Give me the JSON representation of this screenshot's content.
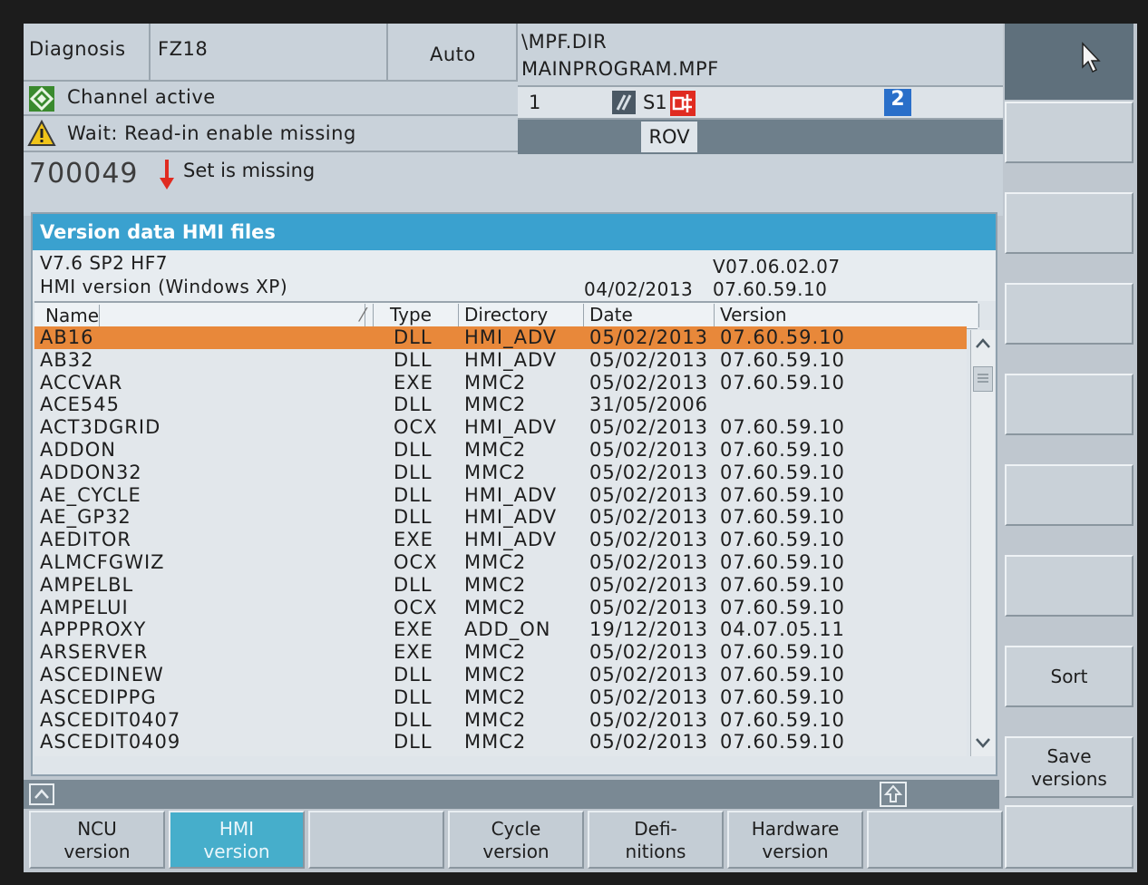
{
  "header": {
    "area": "Diagnosis",
    "channel": "FZ18",
    "mode": "Auto",
    "program_path": "\\MPF.DIR",
    "program_name": "MAINPROGRAM.MPF",
    "channel_status": "Channel active",
    "program_status": "Wait: Read-in enable missing",
    "block_number": "1",
    "spindle": "S1",
    "override": "ROV",
    "channel_number": "2"
  },
  "alarm": {
    "number": "700049",
    "text": "Set is missing"
  },
  "panel": {
    "title": "Version data HMI files",
    "release": "V7.6 SP2 HF7",
    "release_version": "V07.06.02.07",
    "hmi_label": "HMI version (Windows XP)",
    "hmi_date": "04/02/2013",
    "hmi_version": "07.60.59.10"
  },
  "table": {
    "columns": [
      "Name",
      "Type",
      "Directory",
      "Date",
      "Version"
    ],
    "rows": [
      {
        "name": "AB16",
        "type": "DLL",
        "dir": "HMI_ADV",
        "date": "05/02/2013",
        "version": "07.60.59.10"
      },
      {
        "name": "AB32",
        "type": "DLL",
        "dir": "HMI_ADV",
        "date": "05/02/2013",
        "version": "07.60.59.10"
      },
      {
        "name": "ACCVAR",
        "type": "EXE",
        "dir": "MMC2",
        "date": "05/02/2013",
        "version": "07.60.59.10"
      },
      {
        "name": "ACE545",
        "type": "DLL",
        "dir": "MMC2",
        "date": "31/05/2006",
        "version": ""
      },
      {
        "name": "ACT3DGRID",
        "type": "OCX",
        "dir": "HMI_ADV",
        "date": "05/02/2013",
        "version": "07.60.59.10"
      },
      {
        "name": "ADDON",
        "type": "DLL",
        "dir": "MMC2",
        "date": "05/02/2013",
        "version": "07.60.59.10"
      },
      {
        "name": "ADDON32",
        "type": "DLL",
        "dir": "MMC2",
        "date": "05/02/2013",
        "version": "07.60.59.10"
      },
      {
        "name": "AE_CYCLE",
        "type": "DLL",
        "dir": "HMI_ADV",
        "date": "05/02/2013",
        "version": "07.60.59.10"
      },
      {
        "name": "AE_GP32",
        "type": "DLL",
        "dir": "HMI_ADV",
        "date": "05/02/2013",
        "version": "07.60.59.10"
      },
      {
        "name": "AEDITOR",
        "type": "EXE",
        "dir": "HMI_ADV",
        "date": "05/02/2013",
        "version": "07.60.59.10"
      },
      {
        "name": "ALMCFGWIZ",
        "type": "OCX",
        "dir": "MMC2",
        "date": "05/02/2013",
        "version": "07.60.59.10"
      },
      {
        "name": "AMPELBL",
        "type": "DLL",
        "dir": "MMC2",
        "date": "05/02/2013",
        "version": "07.60.59.10"
      },
      {
        "name": "AMPELUI",
        "type": "OCX",
        "dir": "MMC2",
        "date": "05/02/2013",
        "version": "07.60.59.10"
      },
      {
        "name": "APPPROXY",
        "type": "EXE",
        "dir": "ADD_ON",
        "date": "19/12/2013",
        "version": "04.07.05.11"
      },
      {
        "name": "ARSERVER",
        "type": "EXE",
        "dir": "MMC2",
        "date": "05/02/2013",
        "version": "07.60.59.10"
      },
      {
        "name": "ASCEDINEW",
        "type": "DLL",
        "dir": "MMC2",
        "date": "05/02/2013",
        "version": "07.60.59.10"
      },
      {
        "name": "ASCEDIPPG",
        "type": "DLL",
        "dir": "MMC2",
        "date": "05/02/2013",
        "version": "07.60.59.10"
      },
      {
        "name": "ASCEDIT0407",
        "type": "DLL",
        "dir": "MMC2",
        "date": "05/02/2013",
        "version": "07.60.59.10"
      },
      {
        "name": "ASCEDIT0409",
        "type": "DLL",
        "dir": "MMC2",
        "date": "05/02/2013",
        "version": "07.60.59.10"
      }
    ]
  },
  "softkeys_bottom": [
    {
      "line1": "NCU",
      "line2": "version"
    },
    {
      "line1": "HMI",
      "line2": "version"
    },
    {
      "line1": "",
      "line2": ""
    },
    {
      "line1": "Cycle",
      "line2": "version"
    },
    {
      "line1": "Defi-",
      "line2": "nitions"
    },
    {
      "line1": "Hardware",
      "line2": "version"
    },
    {
      "line1": "",
      "line2": ""
    }
  ],
  "softkeys_right": [
    {
      "line1": "",
      "line2": ""
    },
    {
      "line1": "",
      "line2": ""
    },
    {
      "line1": "",
      "line2": ""
    },
    {
      "line1": "",
      "line2": ""
    },
    {
      "line1": "",
      "line2": ""
    },
    {
      "line1": "",
      "line2": ""
    },
    {
      "line1": "Sort",
      "line2": ""
    },
    {
      "line1": "Save",
      "line2": "versions"
    }
  ],
  "colors": {
    "title_bar": "#3aa1cf",
    "selected_row": "#e8883a",
    "active_softkey": "#46aecb",
    "alarm_arrow": "#e02b20",
    "status_ok": "#3a8a2e",
    "warning": "#f0c419"
  },
  "icons": [
    "channel-active-icon",
    "warning-icon",
    "alarm-arrow-icon",
    "feed-hold-icon",
    "spindle-icon",
    "channel-number-icon",
    "mouse-pointer-icon",
    "scroll-up-icon",
    "scroll-down-icon",
    "recall-icon",
    "etc-icon"
  ]
}
